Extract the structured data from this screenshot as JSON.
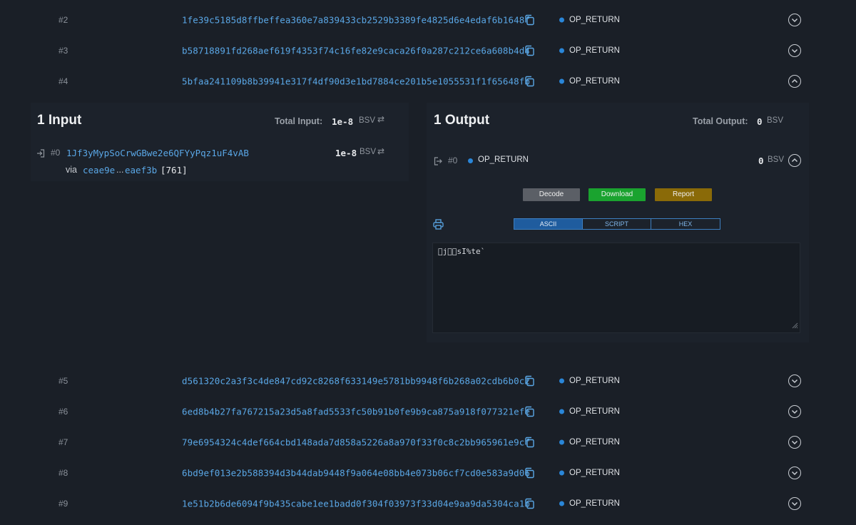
{
  "rows_top": [
    {
      "index": "#2",
      "hash": "1fe39c5185d8ffbeffea360e7a839433cb2529b3389fe4825d6e4edaf6b1648f",
      "type": "OP_RETURN"
    },
    {
      "index": "#3",
      "hash": "b58718891fd268aef619f4353f74c16fe82e9caca26f0a287c212ce6a608b4d4",
      "type": "OP_RETURN"
    },
    {
      "index": "#4",
      "hash": "5bfaa241109b8b39941e317f4df90d3e1bd7884ce201b5e1055531f1f65648fb",
      "type": "OP_RETURN"
    }
  ],
  "inputs": {
    "title": "1 Input",
    "total_label": "Total Input:",
    "total_value": "1e-8",
    "unit": "BSV",
    "items": [
      {
        "index": "#0",
        "address": "1Jf3yMypSoCrwGBwe2e6QFYyPqz1uF4vAB",
        "value": "1e-8",
        "unit": "BSV",
        "via_label": "via",
        "via_tx_start": "ceae9e",
        "via_ellipsis": "...",
        "via_tx_end": "eaef3b",
        "via_index": "[761]"
      }
    ]
  },
  "outputs": {
    "title": "1 Output",
    "total_label": "Total Output:",
    "total_value": "0",
    "unit": "BSV",
    "items": [
      {
        "index": "#0",
        "type": "OP_RETURN",
        "value": "0",
        "unit": "BSV"
      }
    ],
    "actions": {
      "decode": "Decode",
      "download": "Download",
      "report": "Report"
    },
    "tabs": [
      {
        "label": "ASCII",
        "active": true
      },
      {
        "label": "SCRIPT",
        "active": false
      },
      {
        "label": "HEX",
        "active": false
      }
    ],
    "data_text": "\u0000j\u0000\u0000sI%te`"
  },
  "rows_bottom": [
    {
      "index": "#5",
      "hash": "d561320c2a3f3c4de847cd92c8268f633149e5781bb9948f6b268a02cdb6b0c2",
      "type": "OP_RETURN"
    },
    {
      "index": "#6",
      "hash": "6ed8b4b27fa767215a23d5a8fad5533fc50b91b0fe9b9ca875a918f077321efe",
      "type": "OP_RETURN"
    },
    {
      "index": "#7",
      "hash": "79e6954324c4def664cbd148ada7d858a5226a8a970f33f0c8c2bb965961e9cf",
      "type": "OP_RETURN"
    },
    {
      "index": "#8",
      "hash": "6bd9ef013e2b588394d3b44dab9448f9a064e08bb4e073b06cf7cd0e583a9d06",
      "type": "OP_RETURN"
    },
    {
      "index": "#9",
      "hash": "1e51b2b6de6094f9b435cabe1ee1badd0f304f03973f33d04e9aa9da5304ca1b",
      "type": "OP_RETURN"
    }
  ],
  "colors": {
    "link": "#5aa7e6",
    "dot": "#2a86d8",
    "decode": "#5b5f66",
    "download": "#1aa32f",
    "report": "#8a6a08",
    "active_tab": "#1f5c9e"
  },
  "icons": [
    "copy-icon",
    "chevron-down-icon",
    "chevron-up-icon",
    "input-arrow-icon",
    "output-arrow-icon",
    "swap-icon",
    "printer-icon",
    "resize-handle-icon"
  ]
}
